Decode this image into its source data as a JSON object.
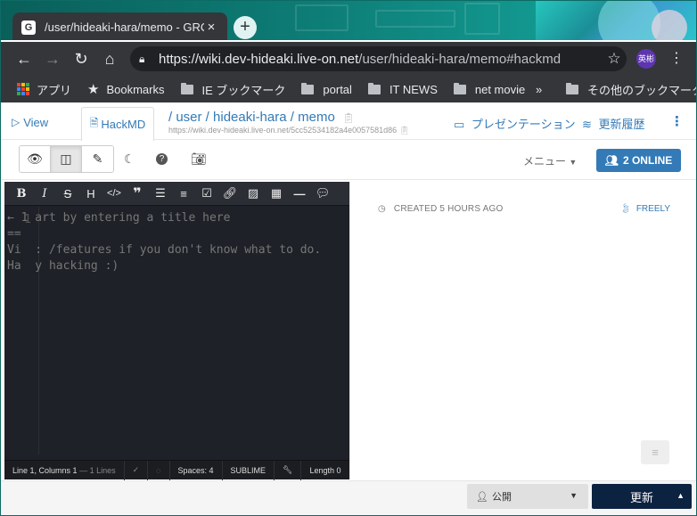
{
  "browser": {
    "tab_title": "/user/hideaki-hara/memo - GRC",
    "tab_favicon": "G",
    "tab_close": "×",
    "new_tab": "+",
    "url_host": "https://wiki.dev-hideaki.live-on.net",
    "url_path": "/user/hideaki-hara/memo#hackmd",
    "profile_label": "英彬",
    "bookmarks": [
      {
        "label": "アプリ",
        "icon": "apps-grid-icon"
      },
      {
        "label": "Bookmarks",
        "icon": "star-icon"
      },
      {
        "label": "IE ブックマーク",
        "icon": "folder-icon"
      },
      {
        "label": "portal",
        "icon": "folder-icon"
      },
      {
        "label": "IT NEWS",
        "icon": "folder-icon"
      },
      {
        "label": "net movie",
        "icon": "folder-icon"
      }
    ],
    "bookmarks_more": "»",
    "other_bookmarks": "その他のブックマーク"
  },
  "header": {
    "view_label": "View",
    "hackmd_label": "HackMD",
    "path_parts": [
      "/ user",
      " / ",
      "hideaki-hara",
      " / ",
      "memo"
    ],
    "path_full": "/ user / hideaki-hara / memo",
    "sub_url": "https://wiki.dev-hideaki.live-on.net/5cc52534182a4e0057581d86",
    "presentation_label": "プレゼンテーション",
    "history_label": "更新履歴"
  },
  "toolbar": {
    "menu_label": "メニュー",
    "online_label": "2 ONLINE"
  },
  "editor": {
    "lines": [
      "←  Start by entering a title here",
      "==",
      "Visit /features if you don't know what to do.",
      "Happy hacking :)"
    ],
    "display_lines": [
      "← 1 art by entering a title here",
      "==",
      "Vi  : /features if you don't know what to do.",
      "Ha  y hacking :)"
    ],
    "gutter_number": "1",
    "status": {
      "position": "Line 1, Columns 1",
      "lines": "— 1 Lines",
      "spaces": "Spaces: 4",
      "keymap": "SUBLIME",
      "length": "Length 0"
    }
  },
  "preview": {
    "created": "CREATED 5 HOURS AGO",
    "permission": "FREELY"
  },
  "bottom": {
    "publish_label": "公開",
    "update_label": "更新"
  },
  "colors": {
    "accent": "#337ab7",
    "editor_bg": "#1e2127",
    "update_button": "#0c2241"
  }
}
